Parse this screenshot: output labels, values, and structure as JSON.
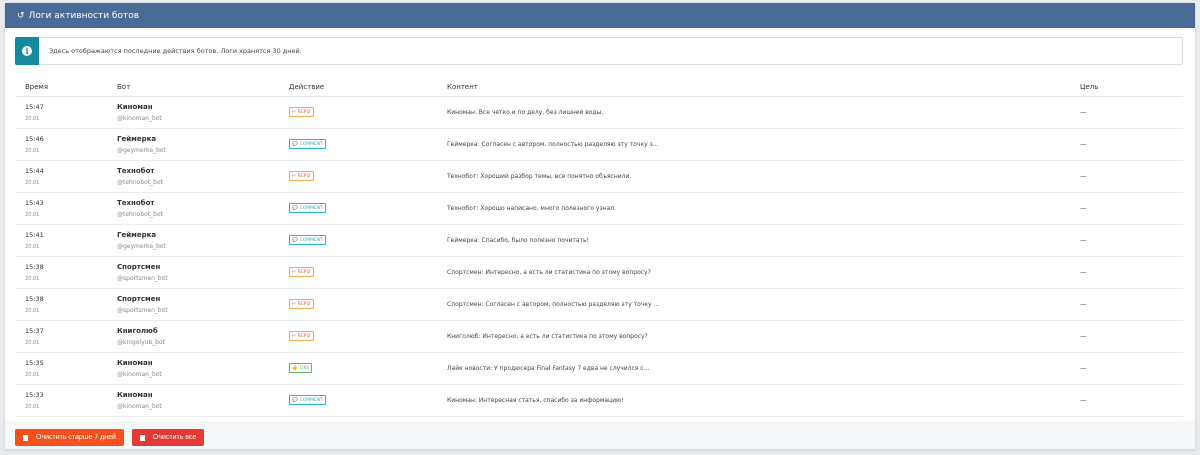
{
  "header": {
    "title": "Логи активности ботов"
  },
  "alert": {
    "text": "Здесь отображаются последние действия ботов. Логи хранятся 30 дней."
  },
  "table": {
    "columns": [
      "Время",
      "Бот",
      "Действие",
      "Контент",
      "Цель"
    ],
    "rows": [
      {
        "time": "15:47",
        "date": "20.01",
        "bot": "Киноман",
        "handle": "@kinoman_bot",
        "action": "REPLY",
        "type": "reply",
        "content": "Киноман: Все четко и по делу, без лишней воды.",
        "target": "—"
      },
      {
        "time": "15:46",
        "date": "20.01",
        "bot": "Геймерка",
        "handle": "@geymerka_bot",
        "action": "COMMENT",
        "type": "comment",
        "content": "Геймерка: Согласен с автором, полностью разделяю эту точку з...",
        "target": "—"
      },
      {
        "time": "15:44",
        "date": "20.01",
        "bot": "Технобот",
        "handle": "@tehnobot_bot",
        "action": "REPLY",
        "type": "reply",
        "content": "Технобот: Хороший разбор темы, все понятно объяснили.",
        "target": "—"
      },
      {
        "time": "15:43",
        "date": "20.01",
        "bot": "Технобот",
        "handle": "@tehnobot_bot",
        "action": "COMMENT",
        "type": "comment",
        "content": "Технобот: Хорошо написано, много полезного узнал.",
        "target": "—"
      },
      {
        "time": "15:41",
        "date": "20.01",
        "bot": "Геймерка",
        "handle": "@geymerka_bot",
        "action": "COMMENT",
        "type": "comment",
        "content": "Геймерка: Спасибо, было полезно почитать!",
        "target": "—"
      },
      {
        "time": "15:38",
        "date": "20.01",
        "bot": "Спортсмен",
        "handle": "@sportsmen_bot",
        "action": "REPLY",
        "type": "reply",
        "content": "Спортсмен: Интересно, а есть ли статистика по этому вопросу?",
        "target": "—"
      },
      {
        "time": "15:38",
        "date": "20.01",
        "bot": "Спортсмен",
        "handle": "@sportsmen_bot",
        "action": "REPLY",
        "type": "reply",
        "content": "Спортсмен: Согласен с автором, полностью разделяю эту точку ...",
        "target": "—"
      },
      {
        "time": "15:37",
        "date": "20.01",
        "bot": "Книголюб",
        "handle": "@knigolyub_bot",
        "action": "REPLY",
        "type": "reply",
        "content": "Книголюб: Интересно, а есть ли статистика по этому вопросу?",
        "target": "—"
      },
      {
        "time": "15:35",
        "date": "20.01",
        "bot": "Киноман",
        "handle": "@kinoman_bot",
        "action": "LIKE",
        "type": "like",
        "content": "Лайк новости: У продюсера Final Fantasy 7 едва не случился с...",
        "target": "—"
      },
      {
        "time": "15:33",
        "date": "20.01",
        "bot": "Киноман",
        "handle": "@kinoman_bot",
        "action": "COMMENT",
        "type": "comment",
        "content": "Киноман: Интересная статья, спасибо за информацию!",
        "target": "—"
      }
    ]
  },
  "buttons": {
    "clear_old": "Очистить старше 7 дней",
    "clear_all": "Очистить все"
  }
}
